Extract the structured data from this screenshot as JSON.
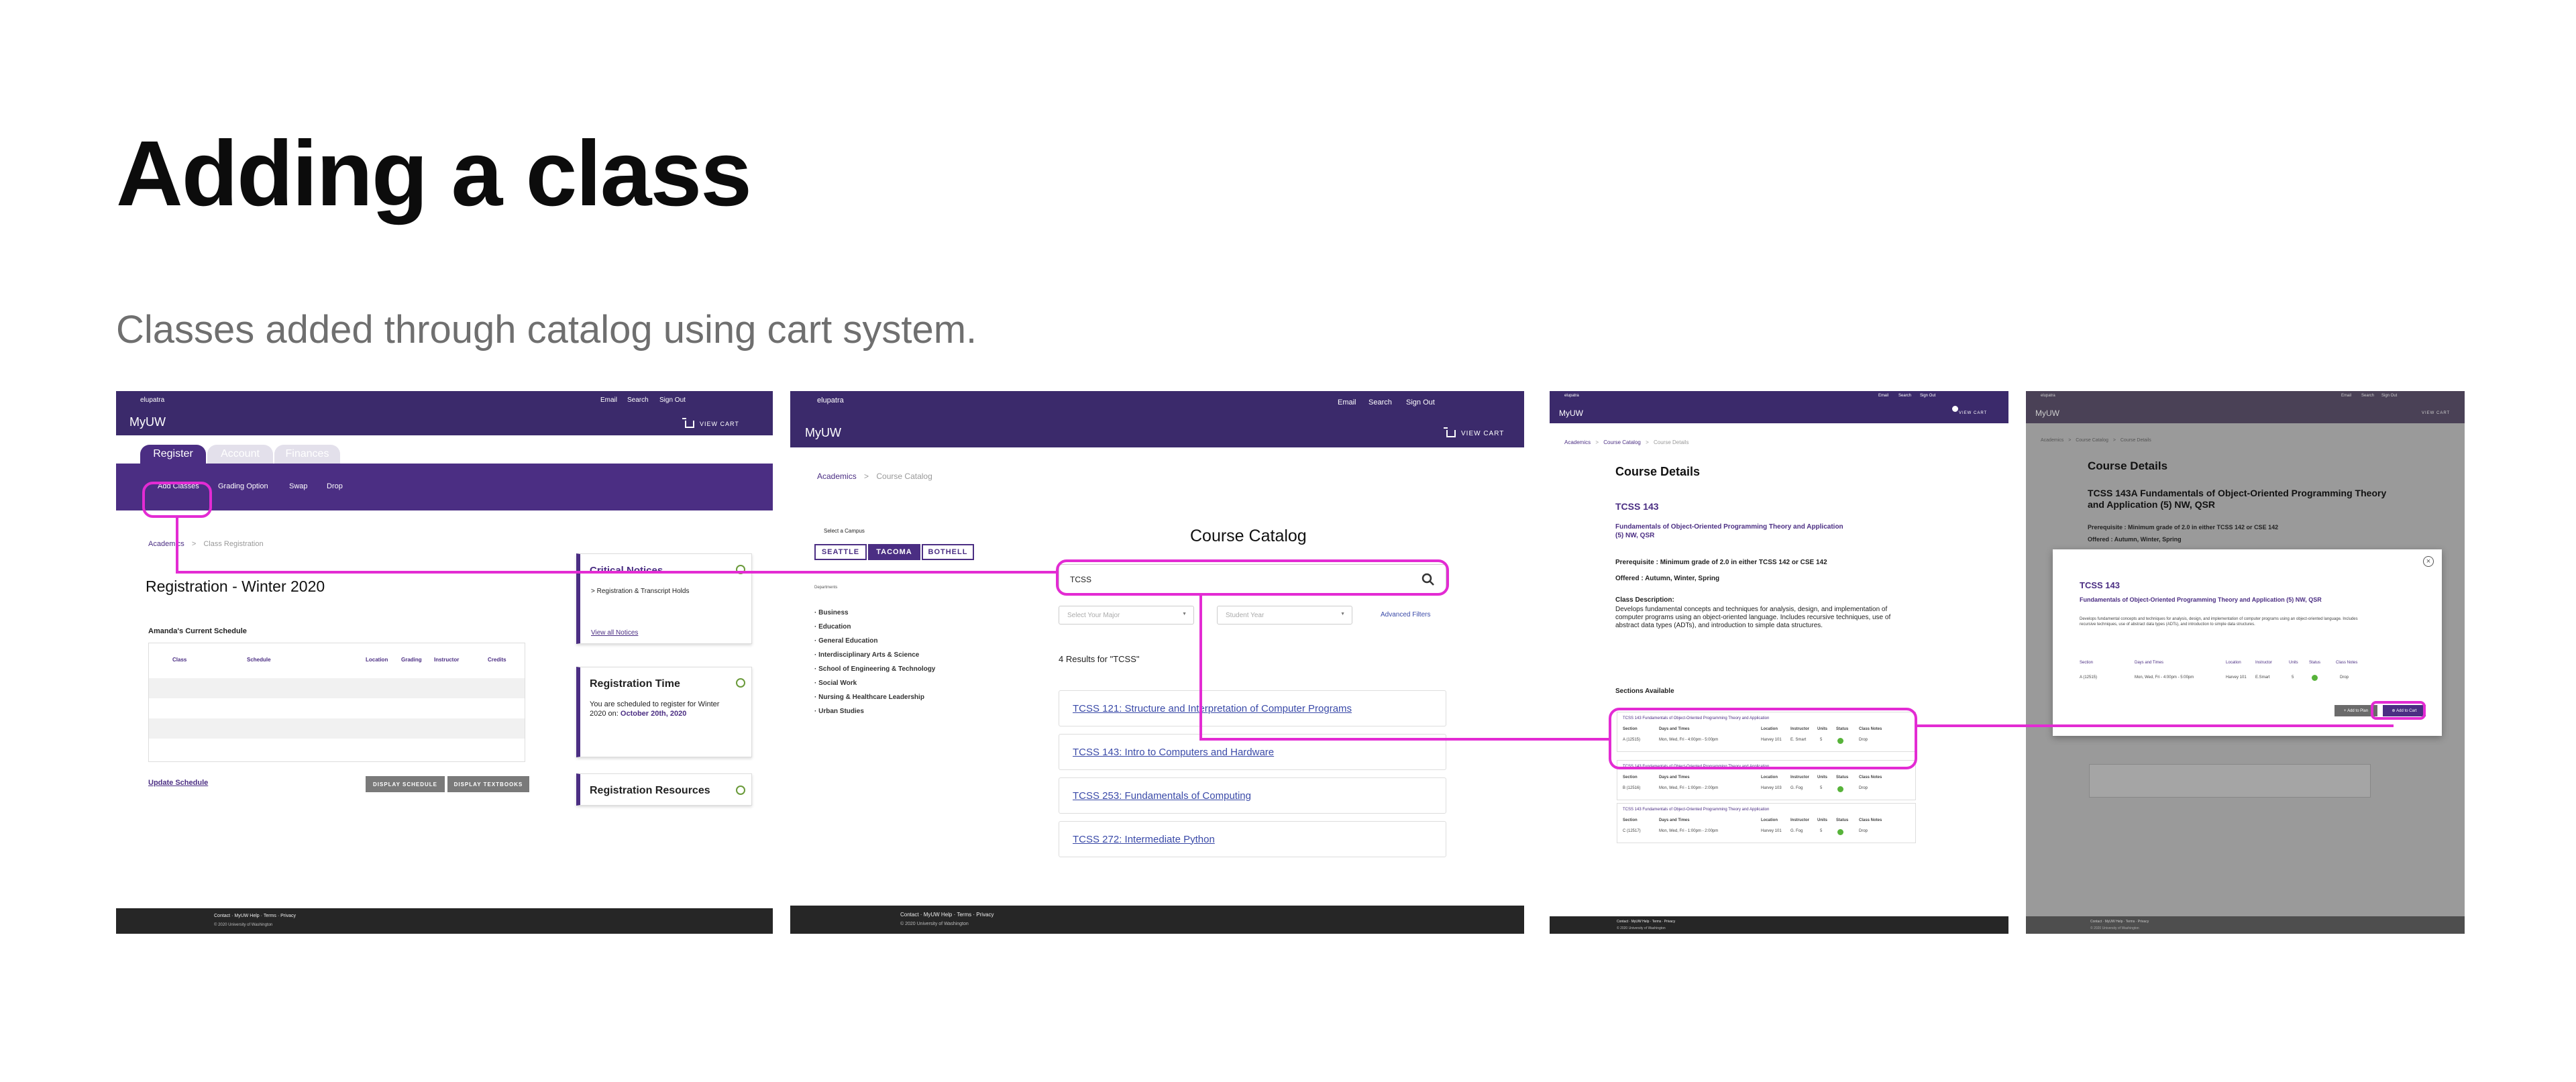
{
  "header": {
    "title": "Adding a class",
    "subtitle": "Classes added through catalog using cart system."
  },
  "common": {
    "username": "elupatra",
    "email": "Email",
    "search": "Search",
    "signout": "Sign Out",
    "brand": "MyUW",
    "view_cart": "VIEW CART",
    "footer_contact": "Contact",
    "footer_help": "MyUW Help",
    "footer_terms": "Terms",
    "footer_privacy": "Privacy",
    "footer_copyright": "© 2020 University of Washington"
  },
  "screen1": {
    "tabs": [
      "Register",
      "Account",
      "Finances"
    ],
    "subnav": [
      "Add Classes",
      "Grading Option",
      "Swap",
      "Drop"
    ],
    "breadcrumb_home": "Academics",
    "breadcrumb_current": "Class Registration",
    "title": "Registration - Winter 2020",
    "schedule_label": "Amanda's Current Schedule",
    "table_columns": [
      "Class",
      "Schedule",
      "Location",
      "Grading",
      "Instructor",
      "Credits"
    ],
    "update_link": "Update Schedule",
    "display_schedule": "DISPLAY SCHEDULE",
    "display_textbooks": "DISPLAY TEXTBOOKS",
    "critical_title": "Critical Notices",
    "critical_item": "Registration & Transcript Holds",
    "view_all": "View all Notices",
    "time_title": "Registration Time",
    "time_text": "You are scheduled to register for Winter 2020 on:",
    "time_date": "October 20th, 2020",
    "resources_title": "Registration Resources"
  },
  "screen2": {
    "breadcrumb_home": "Academics",
    "breadcrumb_current": "Course Catalog",
    "campus_label": "Select a Campus",
    "campuses": [
      "SEATTLE",
      "TACOMA",
      "BOTHELL"
    ],
    "title": "Course Catalog",
    "search_value": "TCSS",
    "major_placeholder": "Select Your Major",
    "year_placeholder": "Student Year",
    "advanced": "Advanced Filters",
    "results_label": "4 Results for \"TCSS\"",
    "dept_header": "Departments",
    "departments": [
      "Business",
      "Education",
      "General Education",
      "Interdisciplinary Arts & Science",
      "School of Engineering & Technology",
      "Social Work",
      "Nursing & Healthcare Leadership",
      "Urban Studies"
    ],
    "results": [
      "TCSS 121: Structure and Interpretation of Computer Programs",
      "TCSS 143: Intro to Computers and Hardware",
      "TCSS 253: Fundamentals of Computing",
      "TCSS 272: Intermediate Python"
    ]
  },
  "screen3": {
    "breadcrumb_home": "Academics",
    "breadcrumb_mid": "Course Catalog",
    "breadcrumb_current": "Course Details",
    "title": "Course Details",
    "course_code": "TCSS 143",
    "course_name": "Fundamentals of Object-Oriented Programming Theory and Application (5) NW, QSR",
    "prereq": "Prerequisite : Minimum grade of 2.0 in either TCSS 142 or CSE 142",
    "offered": "Offered : Autumn, Winter, Spring",
    "desc_label": "Class Description:",
    "desc": "Develops fundamental concepts and techniques for analysis, design, and implementation of computer programs using an object-oriented language. Includes recursive techniques, use of abstract data types (ADTs), and introduction to simple data structures.",
    "sections_label": "Sections Available",
    "section_title": "TCSS 143 Fundamentals of Object-Oriented Programming Theory and Application",
    "section_cols": [
      "Section",
      "Days and Times",
      "Location",
      "Instructor",
      "Units",
      "Status",
      "Class Notes"
    ],
    "sections": [
      {
        "id": "A (12515)",
        "days": "Mon, Wed, Fri - 4:00pm - 5:00pm",
        "loc": "Harvey 101",
        "instr": "E. Smart",
        "units": "5",
        "notes": "Drop"
      },
      {
        "id": "B (12516)",
        "days": "Mon, Wed, Fri - 1:00pm - 2:00pm",
        "loc": "Harvey 103",
        "instr": "G. Fog",
        "units": "5",
        "notes": "Drop"
      },
      {
        "id": "C (12517)",
        "days": "Mon, Wed, Fri - 1:00pm - 2:00pm",
        "loc": "Harvey 101",
        "instr": "G. Fog",
        "units": "5",
        "notes": "Drop"
      }
    ]
  },
  "screen4": {
    "breadcrumb_home": "Academics",
    "breadcrumb_mid": "Course Catalog",
    "breadcrumb_current": "Course Details",
    "title": "Course Details",
    "heading": "TCSS 143A Fundamentals of Object-Oriented Programming Theory and Application (5) NW, QSR",
    "prereq": "Prerequisite : Minimum grade of 2.0 in either TCSS 142 or CSE 142",
    "offered": "Offered : Autumn, Winter, Spring",
    "modal_code": "TCSS 143",
    "modal_name": "Fundamentals of Object-Oriented Programming Theory and Application (5) NW, QSR",
    "modal_desc": "Develops fundamental concepts and techniques for analysis, design, and implementation of computer programs using an object-oriented language. Includes recursive techniques, use of abstract data types (ADTs), and introduction to simple data structures.",
    "modal_cols": [
      "Section",
      "Days and Times",
      "Location",
      "Instructor",
      "Units",
      "Status",
      "Class Notes"
    ],
    "modal_row": {
      "id": "A (12515)",
      "days": "Mon, Wed, Fri - 4:00pm - 5:00pm",
      "loc": "Harvey 101",
      "instr": "E.Smart",
      "units": "5",
      "notes": "Drop"
    },
    "add_to_plan": "Add to Plan",
    "add_to_cart": "Add to Cart"
  }
}
